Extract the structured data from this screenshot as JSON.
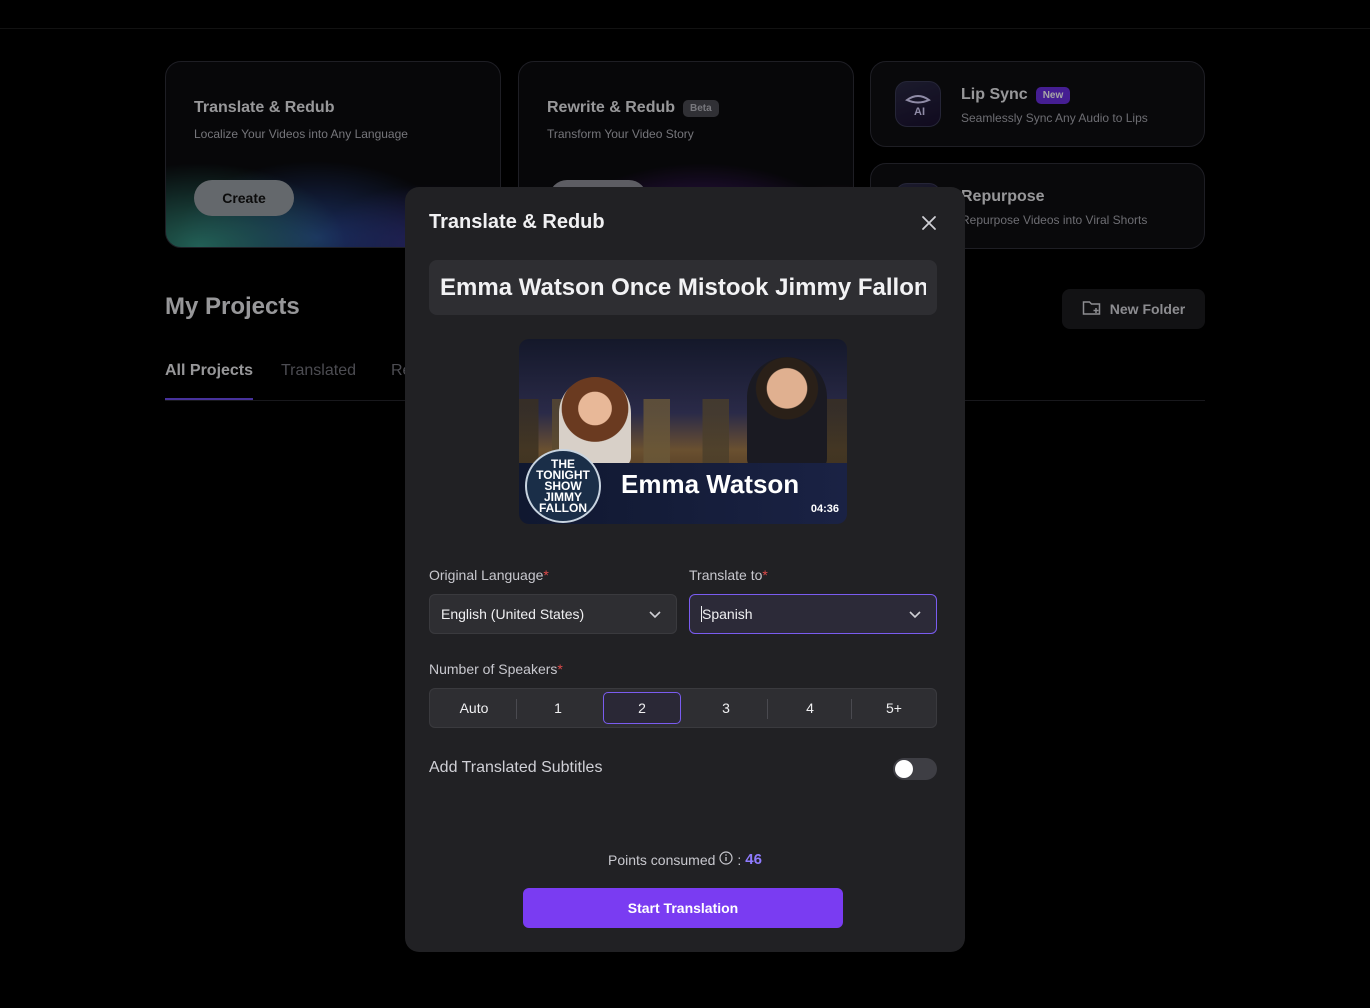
{
  "cards": {
    "translate": {
      "title": "Translate & Redub",
      "subtitle": "Localize Your Videos into Any Language",
      "button": "Create"
    },
    "rewrite": {
      "title": "Rewrite & Redub",
      "badge": "Beta",
      "subtitle": "Transform Your Video Story"
    },
    "lip_sync": {
      "title": "Lip Sync",
      "badge": "New",
      "subtitle": "Seamlessly Sync Any Audio to Lips"
    },
    "repurpose": {
      "title": "Repurpose",
      "subtitle": "Repurpose Videos into Viral Shorts"
    }
  },
  "projects": {
    "title": "My Projects",
    "new_folder": "New Folder",
    "tabs": [
      {
        "label": "All Projects",
        "active": true
      },
      {
        "label": "Translated",
        "active": false
      },
      {
        "label": "Re",
        "active": false
      }
    ]
  },
  "modal": {
    "title": "Translate & Redub",
    "project_name": "Emma Watson Once Mistook Jimmy Fallon for",
    "thumbnail": {
      "logo_text": "THE TONIGHT SHOW JIMMY FALLON",
      "banner_name": "Emma Watson",
      "duration": "04:36"
    },
    "original_language": {
      "label": "Original Language",
      "value": "English (United States)"
    },
    "translate_to": {
      "label": "Translate to",
      "value": "Spanish"
    },
    "speakers": {
      "label": "Number of Speakers",
      "options": [
        "Auto",
        "1",
        "2",
        "3",
        "4",
        "5+"
      ],
      "selected": "2"
    },
    "subtitles": {
      "label": "Add Translated Subtitles",
      "enabled": false
    },
    "points": {
      "label": "Points consumed",
      "separator": ":",
      "value": "46"
    },
    "start_button": "Start Translation"
  },
  "colors": {
    "accent": "#7a3cf2",
    "focus_border": "#7a5cf0",
    "required": "#e04a4a",
    "points": "#8f7bff"
  }
}
